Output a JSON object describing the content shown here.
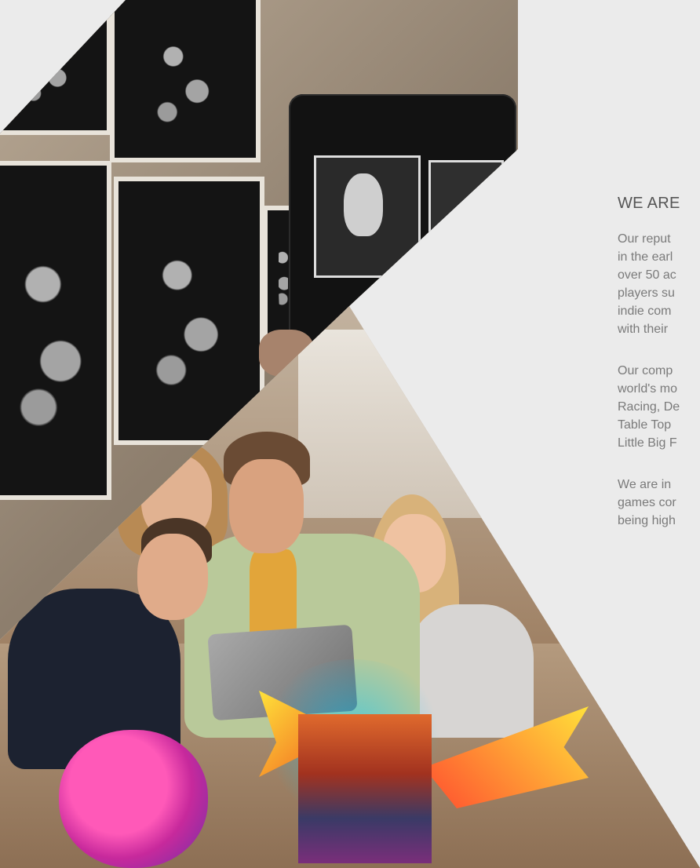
{
  "section": {
    "heading": "WE ARE",
    "paragraphs": [
      {
        "lines": [
          "Our reput",
          "in the earl",
          "over 50 ac",
          "players su",
          "indie com",
          "with their"
        ]
      },
      {
        "lines": [
          "Our comp",
          "world's mo",
          "Racing, De",
          "Table Top",
          "Little Big F"
        ]
      },
      {
        "lines": [
          "We are in",
          "games cor",
          "being high"
        ]
      }
    ]
  },
  "colors": {
    "panel_background": "#ebebeb",
    "heading_text": "#555555",
    "body_text": "#7a7a7a"
  }
}
